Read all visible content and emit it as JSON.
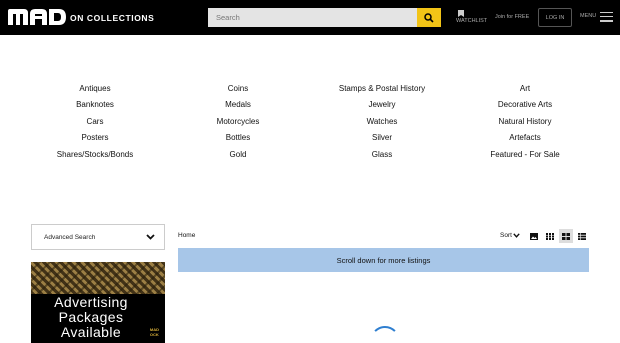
{
  "header": {
    "brand_text": "ON COLLECTIONS",
    "logo_letters": "MAD",
    "search_placeholder": "Search",
    "search_icon": "search-icon",
    "watchlist_label": "WATCHLIST",
    "join_label": "Join for FREE",
    "login_label": "LOG IN",
    "menu_label": "MENU"
  },
  "categories": [
    [
      "Antiques",
      "Banknotes",
      "Cars",
      "Posters",
      "Shares/Stocks/Bonds"
    ],
    [
      "Coins",
      "Medals",
      "Motorcycles",
      "Bottles",
      "Gold"
    ],
    [
      "Stamps & Postal History",
      "Jewelry",
      "Watches",
      "Silver",
      "Glass"
    ],
    [
      "Art",
      "Decorative Arts",
      "Natural History",
      "Artefacts",
      "Featured - For Sale"
    ]
  ],
  "sidebar": {
    "advanced_search_label": "Advanced Search",
    "ad": {
      "lines": [
        "Advertising",
        "Packages",
        "Available"
      ],
      "mini_logo": [
        "MAD",
        "OCK"
      ]
    }
  },
  "main": {
    "breadcrumb": "Home",
    "sort_label": "Sort",
    "view_options": [
      "image-view-icon",
      "grid-view-icon",
      "gallery-view-icon",
      "list-view-icon"
    ],
    "active_view": "gallery-view-icon",
    "scroll_notice": "Scroll down for more listings"
  },
  "colors": {
    "header_bg": "#000000",
    "search_button": "#f2c417",
    "notice_bg": "#a7c6e8",
    "spinner": "#2f7fd0"
  }
}
